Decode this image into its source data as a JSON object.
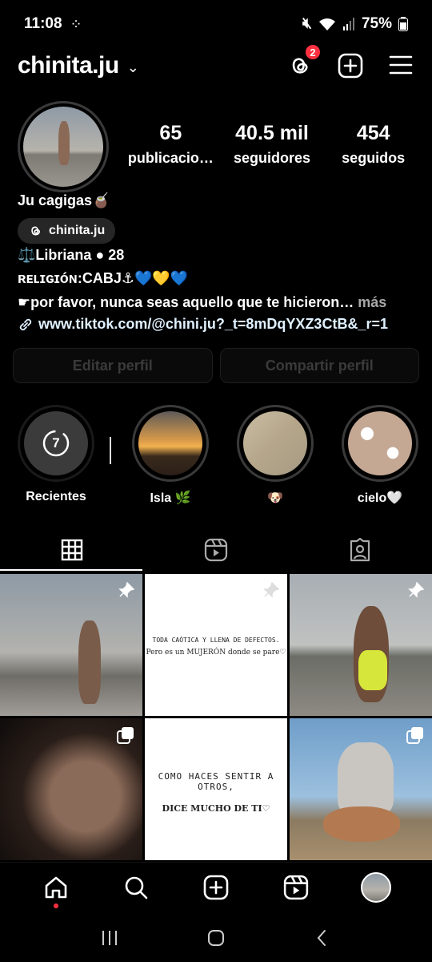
{
  "status_bar": {
    "time": "11:08",
    "battery": "75%"
  },
  "header": {
    "username": "chinita.ju",
    "threads_badge": "2"
  },
  "profile": {
    "stats": [
      {
        "value": "65",
        "label": "publicacio…"
      },
      {
        "value": "40.5 mil",
        "label": "seguidores"
      },
      {
        "value": "454",
        "label": "seguidos"
      }
    ],
    "name": "Ju cagigas🧉",
    "threads_handle": "chinita.ju",
    "bio": [
      "⚖️Libriana ● 28",
      "ʀᴇʟɪɢɪóɴ:CABJ⚓💙💛💙",
      "☛por favor, nunca seas aquello que te hicieron…"
    ],
    "bio_more": " más",
    "link": "www.tiktok.com/@chini.ju?_t=8mDqYXZ3CtB&_r=1"
  },
  "buttons": {
    "edit": "Editar perfil",
    "share": "Compartir perfil"
  },
  "highlights": [
    {
      "label": "Recientes",
      "badge": "7"
    },
    {
      "label": "Isla 🌿"
    },
    {
      "label": "🐶"
    },
    {
      "label": "cielo🤍"
    }
  ],
  "posts": {
    "quote1_line1": "TODA CAÓTICA Y LLENA DE DEFECTOS.",
    "quote1_line2": "Pero es un MUJERÓN donde se pare♡",
    "quote2_line1": "COMO HACES SENTIR A OTROS,",
    "quote2_line2": "DICE MUCHO DE TI♡"
  }
}
